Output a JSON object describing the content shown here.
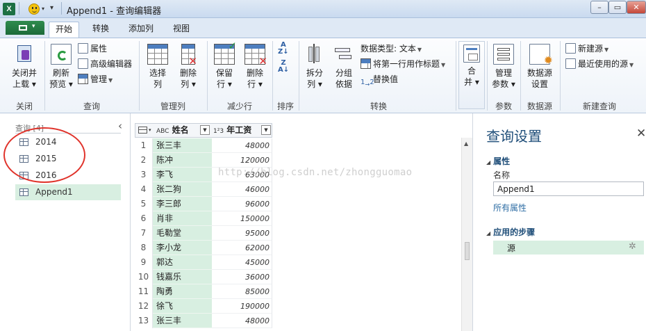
{
  "titlebar": {
    "title": "Append1 - 查询编辑器",
    "qa_caret": "▾",
    "minimize": "–",
    "maximize": "▭",
    "close": "✕"
  },
  "ribbon_tabs": [
    {
      "label": "开始",
      "active": true
    },
    {
      "label": "转换",
      "active": false
    },
    {
      "label": "添加列",
      "active": false
    },
    {
      "label": "视图",
      "active": false
    }
  ],
  "ribbon": {
    "close_group": {
      "btn1": "关闭并",
      "btn2": "上载 ▾",
      "label": "关闭"
    },
    "query_group": {
      "refresh1": "刷新",
      "refresh2": "预览 ▾",
      "properties": "属性",
      "advanced_editor": "高级编辑器",
      "manage": "管理",
      "label": "查询"
    },
    "manage_cols_group": {
      "choose1": "选择",
      "choose2": "列",
      "remove1": "删除",
      "remove2": "列 ▾",
      "label": "管理列"
    },
    "reduce_rows_group": {
      "keep1": "保留",
      "keep2": "行 ▾",
      "remove1": "删除",
      "remove2": "行 ▾",
      "label": "减少行"
    },
    "sort_group": {
      "label": "排序"
    },
    "transform_group": {
      "split1": "拆分",
      "split2": "列 ▾",
      "group1": "分组",
      "group2": "依据",
      "data_type": "数据类型: 文本",
      "use_first_row": "将第一行用作标题",
      "replace_values": "替换值",
      "label": "转换"
    },
    "combine_group": {
      "combine1": "合",
      "combine2": "并 ▾"
    },
    "params_group": {
      "manage1": "管理",
      "manage2": "参数 ▾",
      "label": "参数"
    },
    "datasource_group": {
      "settings1": "数据源",
      "settings2": "设置",
      "label": "数据源"
    },
    "newquery_group": {
      "new_source": "新建源",
      "recent_sources": "最近使用的源",
      "label": "新建查询"
    }
  },
  "queries_panel": {
    "header": "查询 [4]",
    "collapse": "‹",
    "items": [
      {
        "label": "2014",
        "selected": false
      },
      {
        "label": "2015",
        "selected": false
      },
      {
        "label": "2016",
        "selected": false
      },
      {
        "label": "Append1",
        "selected": true
      }
    ]
  },
  "grid": {
    "col1_type": "ABC",
    "col1_name": "姓名",
    "col2_type": "1²3",
    "col2_name": "年工资",
    "rows": [
      {
        "n": "1",
        "name": "张三丰",
        "salary": "48000"
      },
      {
        "n": "2",
        "name": "陈冲",
        "salary": "120000"
      },
      {
        "n": "3",
        "name": "李飞",
        "salary": "63000"
      },
      {
        "n": "4",
        "name": "张二狗",
        "salary": "46000"
      },
      {
        "n": "5",
        "name": "李三郎",
        "salary": "96000"
      },
      {
        "n": "6",
        "name": "肖非",
        "salary": "150000"
      },
      {
        "n": "7",
        "name": "毛勒堂",
        "salary": "95000"
      },
      {
        "n": "8",
        "name": "李小龙",
        "salary": "62000"
      },
      {
        "n": "9",
        "name": "郭达",
        "salary": "45000"
      },
      {
        "n": "10",
        "name": "钱嘉乐",
        "salary": "36000"
      },
      {
        "n": "11",
        "name": "陶勇",
        "salary": "85000"
      },
      {
        "n": "12",
        "name": "徐飞",
        "salary": "190000"
      },
      {
        "n": "13",
        "name": "张三丰",
        "salary": "48000"
      }
    ]
  },
  "watermark": "http://blog.csdn.net/zhongguomao",
  "settings": {
    "title": "查询设置",
    "close": "✕",
    "properties_head": "属性",
    "name_label": "名称",
    "name_value": "Append1",
    "all_properties": "所有属性",
    "steps_head": "应用的步骤",
    "steps": [
      "源"
    ]
  },
  "colors": {
    "accent_green": "#1d6b39",
    "selection_green": "#d8efe1",
    "title_blue": "#1f4e79",
    "annotation_red": "#e0332b"
  }
}
